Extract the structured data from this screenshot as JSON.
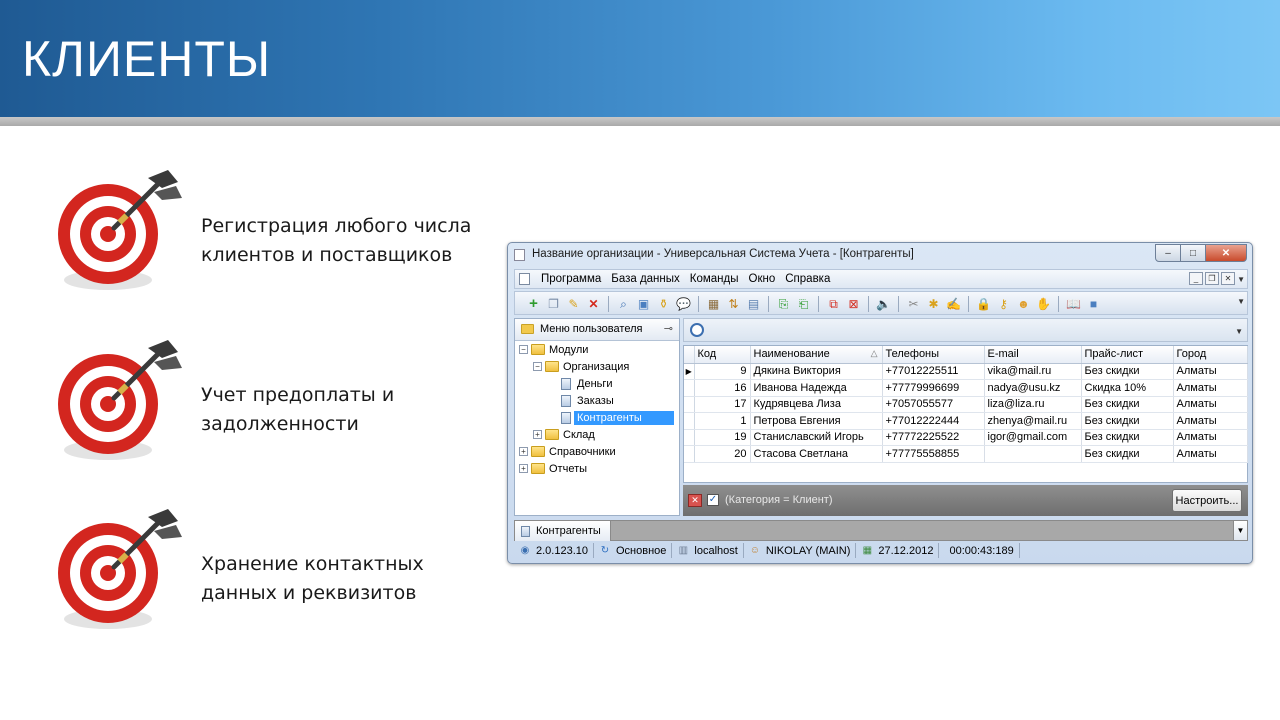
{
  "slide": {
    "title": "КЛИЕНТЫ"
  },
  "bullets": [
    {
      "line1": "Регистрация любого числа",
      "line2": "клиентов и поставщиков",
      "icon": "target-icon"
    },
    {
      "line1": "Учет предоплаты и",
      "line2": "задолженности",
      "icon": "target-icon"
    },
    {
      "line1": "Хранение контактных",
      "line2": "данных и реквизитов",
      "icon": "target-icon"
    }
  ],
  "app": {
    "window_title": "Название организации - Универсальная Система Учета - [Контрагенты]",
    "window_buttons": {
      "minimize": "–",
      "maximize": "□",
      "close": "✕"
    },
    "menu": [
      "Программа",
      "База данных",
      "Команды",
      "Окно",
      "Справка"
    ],
    "mdi_buttons": {
      "minimize": "_",
      "restore": "❐",
      "close": "✕"
    },
    "left_panel": {
      "title": "Меню пользователя",
      "tree": [
        {
          "label": "Модули",
          "level": 0,
          "type": "folder",
          "expander": "−"
        },
        {
          "label": "Организация",
          "level": 1,
          "type": "folder",
          "expander": "−"
        },
        {
          "label": "Деньги",
          "level": 2,
          "type": "doc"
        },
        {
          "label": "Заказы",
          "level": 2,
          "type": "doc"
        },
        {
          "label": "Контрагенты",
          "level": 2,
          "type": "doc",
          "selected": true
        },
        {
          "label": "Склад",
          "level": 1,
          "type": "folder",
          "expander": "+"
        },
        {
          "label": "Справочники",
          "level": 0,
          "type": "folder",
          "expander": "+"
        },
        {
          "label": "Отчеты",
          "level": 0,
          "type": "folder",
          "expander": "+"
        }
      ]
    },
    "grid": {
      "columns": [
        "Код",
        "Наименование",
        "Телефоны",
        "E-mail",
        "Прайс-лист",
        "Город"
      ],
      "sort_column": "Наименование",
      "rows": [
        {
          "code": "9",
          "name": "Дякина Виктория",
          "phone": "+77012225511",
          "email": "vika@mail.ru",
          "price": "Без скидки",
          "city": "Алматы",
          "current": true
        },
        {
          "code": "16",
          "name": "Иванова Надежда",
          "phone": "+77779996699",
          "email": "nadya@usu.kz",
          "price": "Скидка 10%",
          "city": "Алматы"
        },
        {
          "code": "17",
          "name": "Кудрявцева Лиза",
          "phone": "+7057055577",
          "email": "liza@liza.ru",
          "price": "Без скидки",
          "city": "Алматы"
        },
        {
          "code": "1",
          "name": "Петрова Евгения",
          "phone": "+77012222444",
          "email": "zhenya@mail.ru",
          "price": "Без скидки",
          "city": "Алматы"
        },
        {
          "code": "19",
          "name": "Станиславский Игорь",
          "phone": "+77772225522",
          "email": "igor@gmail.com",
          "price": "Без скидки",
          "city": "Алматы"
        },
        {
          "code": "20",
          "name": "Стасова Светлана",
          "phone": "+77775558855",
          "email": "",
          "price": "Без скидки",
          "city": "Алматы"
        }
      ],
      "record_count": "6"
    },
    "filter": {
      "text": "(Категория = Клиент)",
      "setup_label": "Настроить..."
    },
    "tab_label": "Контрагенты",
    "status": {
      "version": "2.0.123.10",
      "mode": "Основное",
      "server": "localhost",
      "user": "NIKOLAY (MAIN)",
      "date": "27.12.2012",
      "timer": "00:00:43:189"
    },
    "colors": {
      "selection": "#3399ff",
      "title_close": "#c94b2c"
    }
  }
}
